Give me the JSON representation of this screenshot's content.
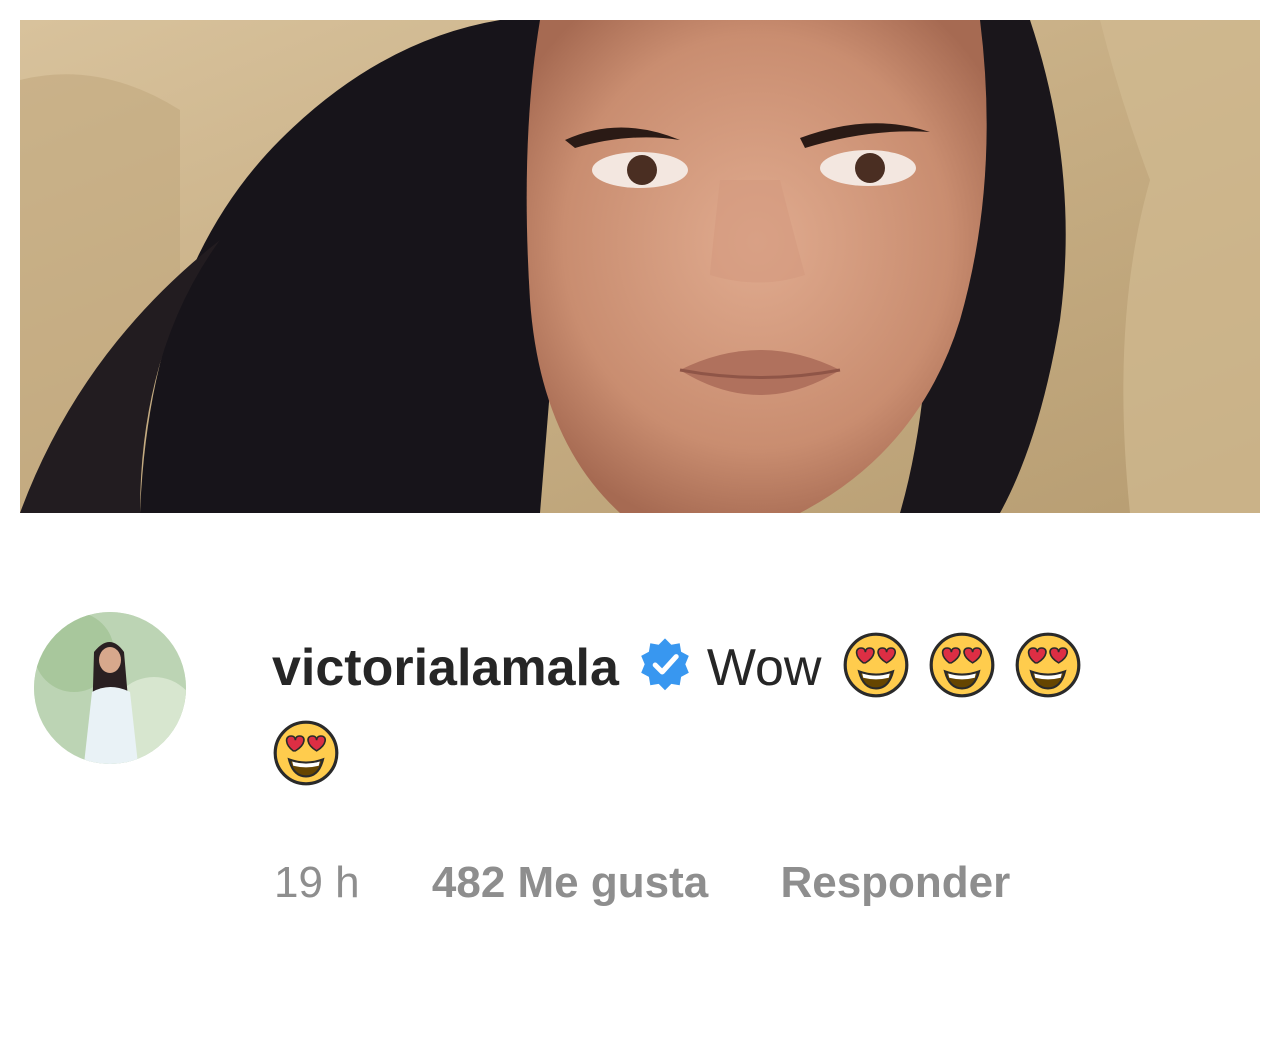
{
  "post": {
    "image_alt": "Close-up selfie of a woman with long dark hair against a sandy rock background"
  },
  "comment": {
    "username": "victorialamala",
    "verified": true,
    "text": "Wow",
    "emojis": [
      "smiling-face-with-heart-eyes",
      "smiling-face-with-heart-eyes",
      "smiling-face-with-heart-eyes",
      "smiling-face-with-heart-eyes"
    ],
    "time": "19 h",
    "likes": "482 Me gusta",
    "reply_label": "Responder"
  },
  "colors": {
    "text_primary": "#262626",
    "text_secondary": "#8e8e8e",
    "verified_blue": "#3897f0",
    "emoji_yellow": "#ffcc4d",
    "heart_red": "#dd2e44"
  }
}
